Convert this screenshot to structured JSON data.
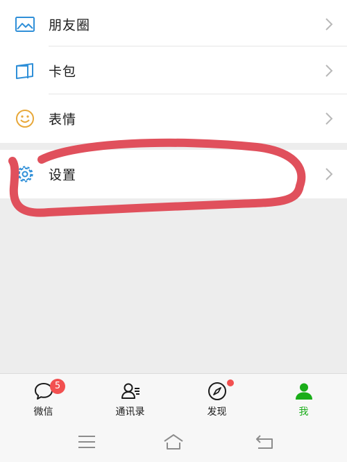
{
  "menu": {
    "moments": {
      "label": "朋友圈",
      "icon": "moments-icon"
    },
    "cards": {
      "label": "卡包",
      "icon": "card-wallet-icon"
    },
    "stickers": {
      "label": "表情",
      "icon": "smiley-icon"
    },
    "settings": {
      "label": "设置",
      "icon": "gear-icon"
    }
  },
  "tabbar": {
    "chats": {
      "label": "微信",
      "badge": "5",
      "icon": "chat-bubble-icon"
    },
    "contacts": {
      "label": "通讯录",
      "icon": "contacts-icon"
    },
    "discover": {
      "label": "发现",
      "icon": "compass-icon",
      "has_dot": true
    },
    "me": {
      "label": "我",
      "icon": "person-icon",
      "active": true
    }
  },
  "colors": {
    "accent_green": "#1aad19",
    "badge_red": "#f25050",
    "icon_blue": "#2f8fd8",
    "icon_orange": "#e8a83a",
    "annotation_red": "#e0505c"
  },
  "system_nav": {
    "menu": "hamburger-icon",
    "home": "home-icon",
    "back": "back-icon"
  }
}
